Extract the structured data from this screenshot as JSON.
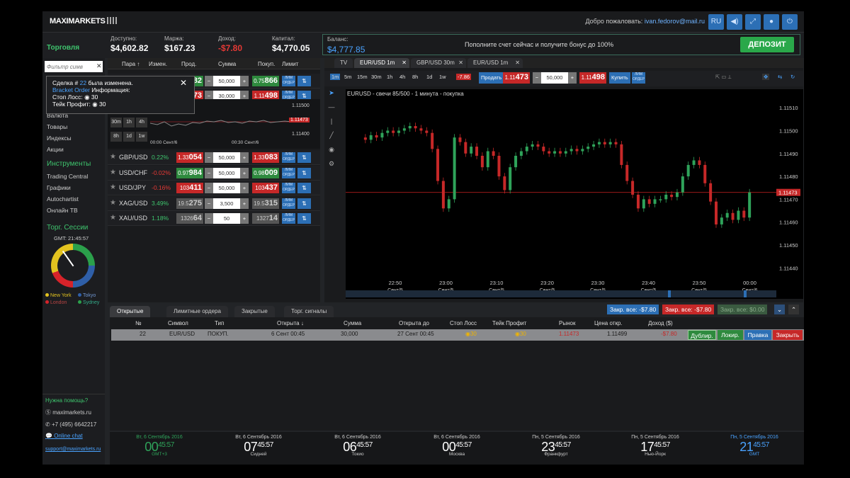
{
  "header": {
    "logo": "MAXIMARKETS",
    "welcome_prefix": "Добро пожаловать:",
    "user_email": "ivan.fedorov@mail.ru",
    "lang": "RU"
  },
  "account": {
    "available_label": "Доступно:",
    "available": "$4,602.82",
    "margin_label": "Маржа:",
    "margin": "$167.23",
    "income_label": "Доход:",
    "income": "-$7.80",
    "capital_label": "Капитал:",
    "capital": "$4,770.05",
    "balance_label": "Баланс:",
    "balance": "$4,777.85",
    "promo": "Пополните счет сейчас и получите бонус до 100%",
    "deposit": "ДЕПОЗИТ"
  },
  "sidebar": {
    "title": "Торговля",
    "filter_placeholder": "Фильтр симв",
    "categories": [
      "Валюта",
      "Товары",
      "Индексы",
      "Акции"
    ],
    "instruments_title": "Инструменты",
    "instruments": [
      "Trading Central",
      "Графики",
      "Autochartist",
      "Онлайн ТВ"
    ],
    "sessions_title": "Торг. Сессии",
    "gmt": "GMT: 21:45:57",
    "sessions": [
      {
        "name": "New York",
        "color": "#e3c31f"
      },
      {
        "name": "Tokyo",
        "color": "#2f5fa8"
      },
      {
        "name": "London",
        "color": "#d6232a"
      },
      {
        "name": "Sydney",
        "color": "#2ba04b"
      }
    ],
    "help_title": "Нужна помощь?",
    "skype": "maximarkets.ru",
    "phone": "+7 (495) 6642217",
    "chat": "Online chat",
    "email": "support@maximarkets.ru"
  },
  "tooltip": {
    "line1_a": "Сделка #",
    "line1_num": "22",
    "line1_b": "была изменена.",
    "line2_a": "Bracket Order",
    "line2_b": "Информация:",
    "line3": "Стоп Лосс: ◉ 30",
    "line4": "Тейк Профит: ◉ 30"
  },
  "quotes": {
    "headers": [
      "Пара ↑",
      "Измен.",
      "Прод.",
      "Сумма",
      "Покуп.",
      "Лимит"
    ],
    "top_rows": [
      {
        "sell_pre": "",
        "sell_big": "82",
        "amount": "50,000",
        "buy_pre": "0.75",
        "buy_big": "866",
        "sell_cls": "g",
        "buy_cls": "g"
      },
      {
        "sell_pre": "",
        "sell_big": "73",
        "amount": "30,000",
        "buy_pre": "1.11",
        "buy_big": "498",
        "sell_cls": "r",
        "buy_cls": "r"
      }
    ],
    "mini_chart": {
      "prices": [
        "1.11500",
        "1.11473",
        "1.11400"
      ],
      "times": [
        "00:00 Сент/6",
        "00:30 Сент/6"
      ],
      "timeframes": [
        "30m",
        "1h",
        "4h",
        "8h",
        "1d",
        "1w"
      ]
    },
    "rows": [
      {
        "symbol": "GBP/USD",
        "change": "0.22%",
        "chg_color": "#3ec46d",
        "sell_pre": "1.33",
        "sell_big": "054",
        "sell_cls": "r",
        "amount": "50,000",
        "buy_pre": "1.33",
        "buy_big": "083",
        "buy_cls": "r"
      },
      {
        "symbol": "USD/CHF",
        "change": "-0.02%",
        "chg_color": "#e53935",
        "sell_pre": "0.97",
        "sell_big": "984",
        "sell_cls": "g",
        "amount": "50,000",
        "buy_pre": "0.98",
        "buy_big": "009",
        "buy_cls": "g"
      },
      {
        "symbol": "USD/JPY",
        "change": "-0.16%",
        "chg_color": "#e53935",
        "sell_pre": "103",
        "sell_big": "411",
        "sell_cls": "r",
        "amount": "50,000",
        "buy_pre": "103",
        "buy_big": "437",
        "buy_cls": "r"
      },
      {
        "symbol": "XAG/USD",
        "change": "3.49%",
        "chg_color": "#3ec46d",
        "sell_pre": "19.5",
        "sell_big": "275",
        "sell_cls": "gray",
        "amount": "3,500",
        "buy_pre": "19.5",
        "buy_big": "315",
        "buy_cls": "gray"
      },
      {
        "symbol": "XAU/USD",
        "change": "1.18%",
        "chg_color": "#3ec46d",
        "sell_pre": "1326",
        "sell_big": "64",
        "sell_cls": "gray",
        "amount": "50",
        "buy_pre": "1327",
        "buy_big": "14",
        "buy_cls": "gray"
      }
    ],
    "limit_label": "ЛИМ ОРДЕР"
  },
  "chart": {
    "tabs": [
      "TV",
      "EUR/USD 1m",
      "GBP/USD 30m",
      "EUR/USD 1m"
    ],
    "timeframes": [
      "1m",
      "5m",
      "15m",
      "30m",
      "1h",
      "4h",
      "8h",
      "1d",
      "1w"
    ],
    "spread": "-7.86",
    "sell_label": "Продать",
    "sell_pre": "1.11",
    "sell_big": "473",
    "amount": "50,000",
    "buy_pre": "1.11",
    "buy_big": "498",
    "buy_label": "Купить",
    "title": "EURUSD - свечи 85/500 - 1 минута - покупка",
    "y_ticks": [
      "1.11510",
      "1.11500",
      "1.11490",
      "1.11480",
      "1.11470",
      "1.11460",
      "1.11450",
      "1.11440"
    ],
    "x_ticks": [
      {
        "t": "22:50",
        "d": "Сент/5"
      },
      {
        "t": "23:00",
        "d": "Сент/5"
      },
      {
        "t": "23:10",
        "d": "Сент/5"
      },
      {
        "t": "23:20",
        "d": "Сент/5"
      },
      {
        "t": "23:30",
        "d": "Сент/5"
      },
      {
        "t": "23:40",
        "d": "Сент/5"
      },
      {
        "t": "23:50",
        "d": "Сент/5"
      },
      {
        "t": "00:00",
        "d": "Сент/6"
      }
    ],
    "current_price": "1.11473"
  },
  "positions": {
    "tabs": [
      "Открытые",
      "Лимитные ордера",
      "Закрытые",
      "Торг. сигналы"
    ],
    "close_buttons": [
      "Закр. все: -$7.80",
      "Закр. все: -$7.80",
      "Закр. все: $0.00"
    ],
    "headers": [
      "№",
      "Символ",
      "Тип",
      "Открыта ↓",
      "Сумма",
      "Открыта до",
      "Стоп Лосс",
      "Тейк Профит",
      "Рынок",
      "Цена откр.",
      "Доход ($)"
    ],
    "row": {
      "num": "22",
      "symbol": "EUR/USD",
      "type": "ПОКУП.",
      "opened": "6 Сент 00:45",
      "amount": "30,000",
      "until": "27 Сент 00:45",
      "sl": "◉30",
      "tp": "◉30",
      "market": "1.11473",
      "open_price": "1.11499",
      "profit": "-$7.80"
    },
    "actions": [
      "Дублир.",
      "Локир.",
      "Правка",
      "Закрыть"
    ]
  },
  "clocks": [
    {
      "date": "Вт, 6 Сентябрь 2016",
      "hh": "00",
      "mmss": "45:57",
      "city": "GMT+3",
      "style": "green"
    },
    {
      "date": "Вт, 6 Сентябрь 2016",
      "hh": "07",
      "mmss": "45:57",
      "city": "Сидней",
      "style": ""
    },
    {
      "date": "Вт, 6 Сентябрь 2016",
      "hh": "06",
      "mmss": "45:57",
      "city": "Токио",
      "style": ""
    },
    {
      "date": "Вт, 6 Сентябрь 2016",
      "hh": "00",
      "mmss": "45:57",
      "city": "Москва",
      "style": ""
    },
    {
      "date": "Пн, 5 Сентябрь 2016",
      "hh": "23",
      "mmss": "45:57",
      "city": "Франкфурт",
      "style": ""
    },
    {
      "date": "Пн, 5 Сентябрь 2016",
      "hh": "17",
      "mmss": "45:57",
      "city": "Нью-Йорк",
      "style": ""
    },
    {
      "date": "Пн, 5 Сентябрь 2016",
      "hh": "21",
      "mmss": "45:57",
      "city": "GMT",
      "style": "blue"
    }
  ]
}
